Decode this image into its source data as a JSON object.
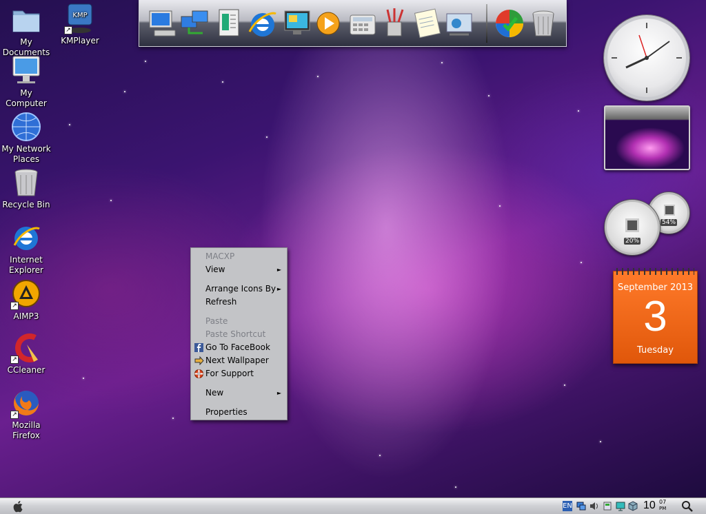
{
  "desktop": {
    "icons": [
      {
        "id": "my-documents",
        "label": "My Documents",
        "icon": "folder-icon"
      },
      {
        "id": "kmplayer",
        "label": "KMPlayer",
        "icon": "kmplayer-icon"
      },
      {
        "id": "my-computer",
        "label": "My Computer",
        "icon": "computer-icon"
      },
      {
        "id": "my-network",
        "label": "My Network Places",
        "icon": "network-globe-icon"
      },
      {
        "id": "recycle-bin",
        "label": "Recycle Bin",
        "icon": "trash-icon"
      },
      {
        "id": "internet-explorer",
        "label": "Internet Explorer",
        "icon": "ie-icon"
      },
      {
        "id": "aimp3",
        "label": "AIMP3",
        "icon": "aimp-icon"
      },
      {
        "id": "ccleaner",
        "label": "CCleaner",
        "icon": "ccleaner-icon"
      },
      {
        "id": "firefox",
        "label": "Mozilla Firefox",
        "icon": "firefox-icon"
      }
    ],
    "kmp_badge": "KMP"
  },
  "dock": {
    "items": [
      "computer-icon",
      "network-computers-icon",
      "documents-icon",
      "ie-icon",
      "display-icon",
      "media-player-icon",
      "calculator-icon",
      "paint-brushes-icon",
      "notepad-icon",
      "control-panel-icon",
      "windows-flag-icon",
      "trash-icon"
    ]
  },
  "widgets": {
    "gauge_cpu": "20%",
    "gauge_mem": "54%",
    "calendar": {
      "month": "September 2013",
      "day": "3",
      "weekday": "Tuesday"
    }
  },
  "context_menu": {
    "header": "MACXP",
    "view": "View",
    "arrange": "Arrange Icons By",
    "refresh": "Refresh",
    "paste": "Paste",
    "paste_shortcut": "Paste Shortcut",
    "facebook": "Go To FaceBook",
    "next_wallpaper": "Next Wallpaper",
    "support": "For Support",
    "new": "New",
    "properties": "Properties",
    "arrow": "►"
  },
  "taskbar": {
    "lang": "EN",
    "time_hour": "10",
    "time_min": "07",
    "time_ampm": "PM"
  }
}
